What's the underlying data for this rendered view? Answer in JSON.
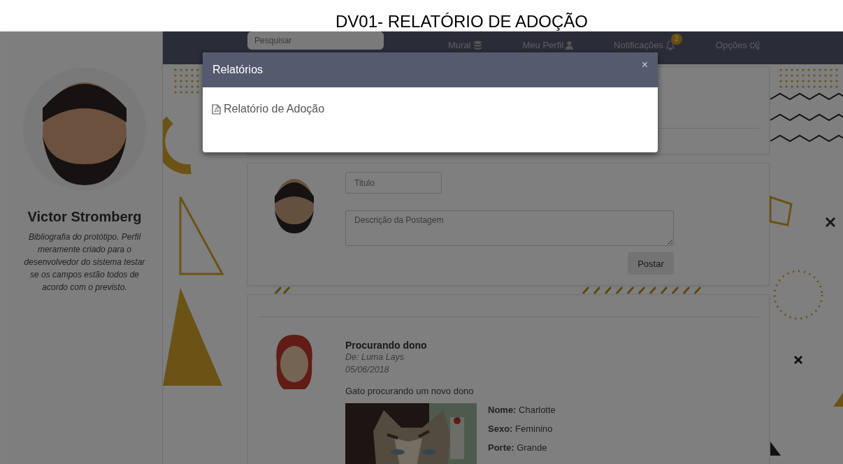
{
  "page_title": "DV01- RELATÓRIO DE ADOÇÃO",
  "sidebar": {
    "name": "Victor Stromberg",
    "bio": "Bibliografia do protótipo. Perfil meramente criado para o desenvolvedor do sistema testar se os campos estão todos de acordo com o previsto."
  },
  "navbar": {
    "search": {
      "placeholder": "Pesquisar"
    },
    "items": [
      {
        "label": "Mural",
        "kind": "database"
      },
      {
        "label": "Meu Perfil",
        "kind": "user"
      },
      {
        "label": "Notificações",
        "kind": "bell",
        "badge": "2"
      },
      {
        "label": "Opções",
        "kind": "gears"
      }
    ]
  },
  "post_form": {
    "title_placeholder": "Titulo",
    "description_placeholder": "Descrição da Postagem",
    "button": "Postar"
  },
  "posts": [
    {
      "title": "Procurando dono",
      "author": "De: Luma Lays",
      "date": "05/06/2018",
      "text": "Gato procurando um novo dono",
      "photo": {
        "kind": "picture"
      },
      "details": [
        {
          "label": "Nome:",
          "value": "Charlotte"
        },
        {
          "label": "Sexo:",
          "value": "Feminino"
        },
        {
          "label": "Porte:",
          "value": "Grande"
        }
      ]
    }
  ],
  "modal": {
    "title": "Relatórios",
    "close": "×",
    "links": [
      {
        "label": "Relatório de Adoção"
      }
    ]
  }
}
